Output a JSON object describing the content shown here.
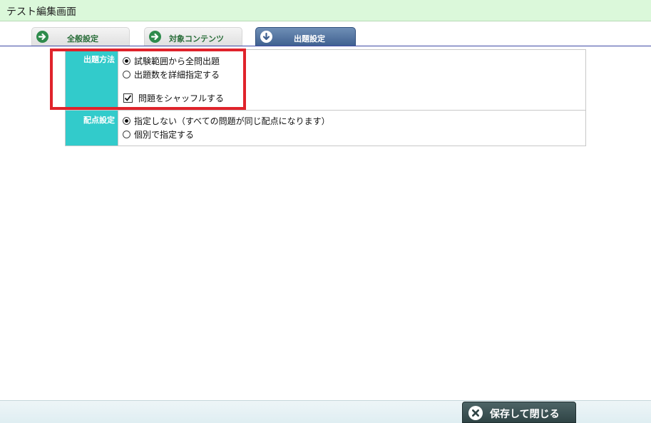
{
  "window": {
    "title": "テスト編集画面"
  },
  "tabs": [
    {
      "label": "全般設定",
      "icon": "arrow-right-circle-icon",
      "active": false
    },
    {
      "label": "対象コンテンツ",
      "icon": "arrow-right-circle-icon",
      "active": false
    },
    {
      "label": "出題設定",
      "icon": "arrow-down-circle-icon",
      "active": true
    }
  ],
  "form": {
    "question_method": {
      "label": "出題方法",
      "options": [
        {
          "label": "試験範囲から全問出題",
          "checked": true
        },
        {
          "label": "出題数を詳細指定する",
          "checked": false
        }
      ],
      "shuffle": {
        "label": "問題をシャッフルする",
        "checked": true
      }
    },
    "score_setting": {
      "label": "配点設定",
      "options": [
        {
          "label": "指定しない（すべての問題が同じ配点になります）",
          "checked": true
        },
        {
          "label": "個別で指定する",
          "checked": false
        }
      ]
    }
  },
  "footer": {
    "save_close_label": "保存して閉じる",
    "save_icon": "close-circle-icon"
  },
  "colors": {
    "title_bar_bg": "#dbf8da",
    "label_cell_bg": "#32cbcb",
    "active_tab_bg": "#3e5f8f",
    "highlight_border": "#e0232b",
    "save_button_bg": "#2f4445"
  }
}
